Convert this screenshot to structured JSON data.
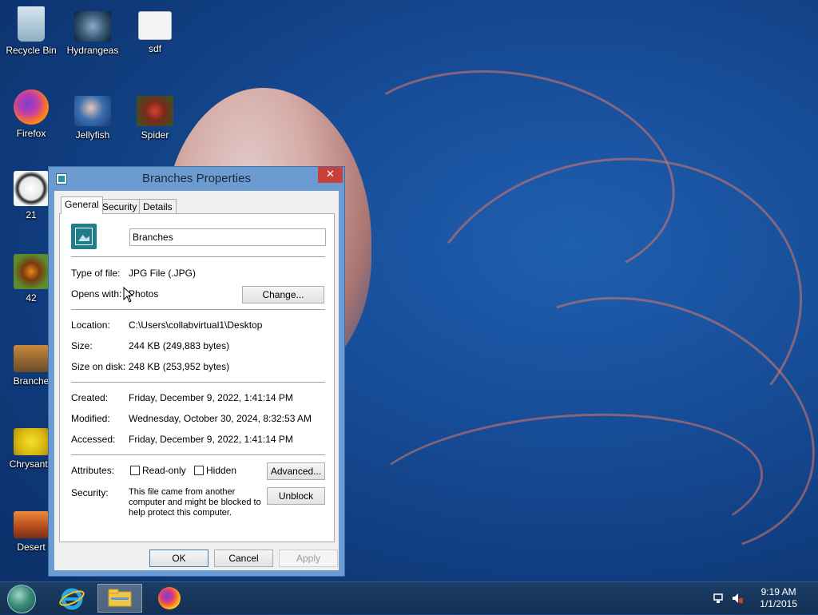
{
  "desktop": {
    "icons": [
      {
        "label": "Recycle Bin"
      },
      {
        "label": "Hydrangeas"
      },
      {
        "label": "sdf"
      },
      {
        "label": "Firefox"
      },
      {
        "label": "Jellyfish"
      },
      {
        "label": "Spider"
      },
      {
        "label": "21"
      },
      {
        "label": "42"
      },
      {
        "label": "Branche"
      },
      {
        "label": "Chrysanth"
      },
      {
        "label": "Desert"
      }
    ]
  },
  "dialog": {
    "title": "Branches Properties",
    "close_glyph": "✕",
    "tabs": [
      {
        "label": "General",
        "active": true
      },
      {
        "label": "Security",
        "active": false
      },
      {
        "label": "Details",
        "active": false
      }
    ],
    "file_name": "Branches",
    "type_of_file_label": "Type of file:",
    "type_of_file_value": "JPG File (.JPG)",
    "opens_with_label": "Opens with:",
    "opens_with_value": "Photos",
    "change_button": "Change...",
    "location_label": "Location:",
    "location_value": "C:\\Users\\collabvirtual1\\Desktop",
    "size_label": "Size:",
    "size_value": "244 KB (249,883 bytes)",
    "size_on_disk_label": "Size on disk:",
    "size_on_disk_value": "248 KB (253,952 bytes)",
    "created_label": "Created:",
    "created_value": "Friday, December 9, 2022, 1:41:14 PM",
    "modified_label": "Modified:",
    "modified_value": "Wednesday, October 30, 2024, 8:32:53 AM",
    "accessed_label": "Accessed:",
    "accessed_value": "Friday, December 9, 2022, 1:41:14 PM",
    "attributes_label": "Attributes:",
    "readonly_label": "Read-only",
    "hidden_label": "Hidden",
    "advanced_button": "Advanced...",
    "security_label": "Security:",
    "security_text": "This file came from another computer and might be blocked to help protect this computer.",
    "unblock_button": "Unblock",
    "ok_button": "OK",
    "cancel_button": "Cancel",
    "apply_button": "Apply"
  },
  "taskbar": {
    "pinned": [
      "internet-explorer",
      "file-explorer",
      "firefox"
    ],
    "clock_time": "9:19 AM",
    "clock_date": "1/1/2015"
  },
  "colors": {
    "accent": "#6b9bd0",
    "close": "#c7413a",
    "desktop": "#174d98"
  }
}
